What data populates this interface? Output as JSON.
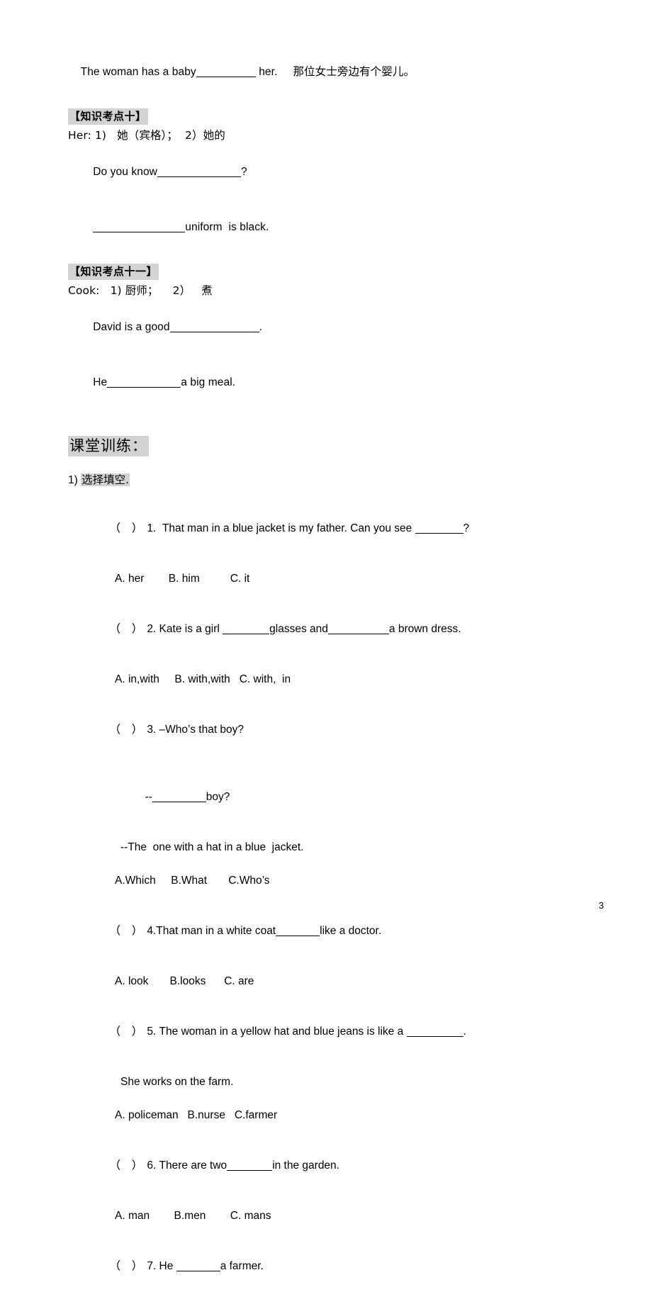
{
  "document": {
    "page_number": "3",
    "highlight_color": "#d3d3d3",
    "text_color": "#000000",
    "background_color": "#ffffff"
  },
  "top_sentence": {
    "before_blank": "The woman has a baby",
    "after_blank": "her.",
    "translation": "那位女士旁边有个婴儿。"
  },
  "knowledge_points": [
    {
      "header": "【知识考点十】",
      "definition": "Her: 1)   她（宾格）；  2）她的",
      "examples": [
        {
          "before": "Do you know",
          "after": "?"
        },
        {
          "before": "",
          "after": "uniform  is black."
        }
      ]
    },
    {
      "header": "【知识考点十一】",
      "definition": "Cook:   1) 厨师；    2）   煮",
      "examples": [
        {
          "before": "David is a good",
          "after": "."
        },
        {
          "before": "He",
          "after": "a big meal."
        }
      ]
    }
  ],
  "section": {
    "heading": "课堂训练：",
    "subsection_number": "1)",
    "subsection_label": "选择填空."
  },
  "questions": [
    {
      "paren": "（  ）",
      "number": "1.",
      "stem_before": "  That man in a blue jacket is my father. Can you see ",
      "stem_after": "?",
      "continuation": null,
      "options": "A. her        B. him          C. it"
    },
    {
      "paren": "（  ）",
      "number": "2.",
      "stem_before": " Kate is a girl ",
      "stem_mid": "glasses and",
      "stem_after": "a brown dress.",
      "continuation": null,
      "options": "A. in,with     B. with,with   C. with,  in"
    },
    {
      "paren": "（  ）",
      "number": "3.",
      "stem_before": " –Who’s that boy?",
      "stem_after": "",
      "continuation_before": "--",
      "continuation_after": "boy?",
      "continuation2": "--The  one with a hat in a blue  jacket.",
      "options": "A.Which     B.What       C.Who’s"
    },
    {
      "paren": "（  ）",
      "number": "4.",
      "stem_before": "That man in a white coat",
      "stem_after": "like a doctor.",
      "continuation": null,
      "options": "A. look       B.looks      C. are"
    },
    {
      "paren": "（  ）",
      "number": "5.",
      "stem_before": " The woman in a yellow hat and blue jeans is like a ",
      "stem_after": ".",
      "continuation": "She works on the farm.",
      "options": "A. policeman   B.nurse   C.farmer"
    },
    {
      "paren": "（  ）",
      "number": "6.",
      "stem_before": " There are two",
      "stem_after": "in the garden.",
      "continuation": null,
      "options": "A. man        B.men        C. mans"
    },
    {
      "paren": "（  ）",
      "number": "7.",
      "stem_before": " He ",
      "stem_after": "a farmer.",
      "continuation": null,
      "options": null
    }
  ]
}
